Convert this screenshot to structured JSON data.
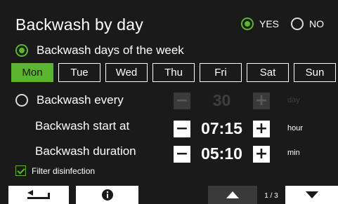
{
  "header": {
    "title": "Backwash by day",
    "yes_label": "YES",
    "no_label": "NO",
    "selected": "YES"
  },
  "mode_week": {
    "label": "Backwash days of the week",
    "selected": true
  },
  "days": [
    {
      "label": "Mon",
      "selected": true
    },
    {
      "label": "Tue",
      "selected": false
    },
    {
      "label": "Wed",
      "selected": false
    },
    {
      "label": "Thu",
      "selected": false
    },
    {
      "label": "Fri",
      "selected": false
    },
    {
      "label": "Sat",
      "selected": false
    },
    {
      "label": "Sun",
      "selected": false
    }
  ],
  "mode_every": {
    "label": "Backwash every",
    "selected": false,
    "value": "30",
    "unit": "day"
  },
  "start": {
    "label": "Backwash start at",
    "value": "07:15",
    "unit": "hour"
  },
  "duration": {
    "label": "Backwash duration",
    "value": "05:10",
    "unit": "min"
  },
  "disinfection": {
    "label": "Filter disinfection",
    "checked": true
  },
  "footer": {
    "page": "1 / 3"
  },
  "colors": {
    "accent": "#5cb52e",
    "background": "#1a1a1a",
    "text": "#ffffff",
    "disabled": "#3e3e3e"
  },
  "icons": {
    "back": "return-arrow-icon",
    "info": "info-icon",
    "up": "triangle-up-icon",
    "down": "triangle-down-icon"
  }
}
